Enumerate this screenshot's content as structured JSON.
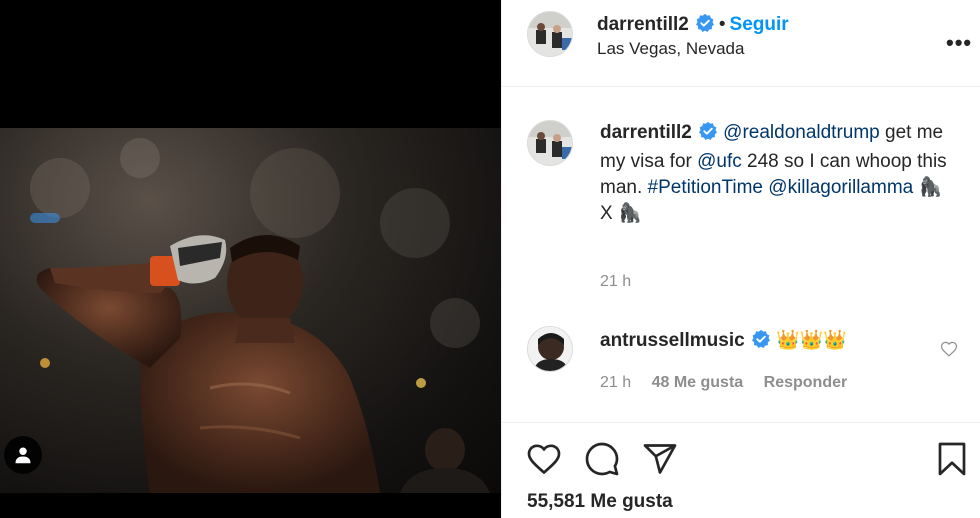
{
  "post": {
    "author": "darrentill2",
    "follow_label": "Seguir",
    "separator": "•",
    "location": "Las Vegas, Nevada",
    "more_label": "•••"
  },
  "caption": {
    "author": "darrentill2",
    "mention_trump": "@realdonaldtrump",
    "text1": " get me my visa for ",
    "mention_ufc": "@ufc",
    "text2": " 248 so I can whoop this man.",
    "hashtag": "#PetitionTime",
    "mention_killa": "@killagorillamma",
    "gorilla1": "🦍",
    "x_text": " X ",
    "gorilla2": "🦍",
    "time": "21 h"
  },
  "comment": {
    "author": "antrussellmusic",
    "crowns": "👑👑👑",
    "time": "21 h",
    "likes": "48 Me gusta",
    "reply_label": "Responder"
  },
  "footer": {
    "likes": "55,581 Me gusta"
  },
  "colors": {
    "link_blue": "#00376b",
    "follow_blue": "#0095f6",
    "verified_blue": "#3897f0",
    "muted": "#8e8e8e"
  },
  "icons": [
    "user-tag-icon",
    "verified-icon",
    "more-options-icon",
    "heart-icon",
    "comment-icon",
    "share-icon",
    "bookmark-icon"
  ]
}
